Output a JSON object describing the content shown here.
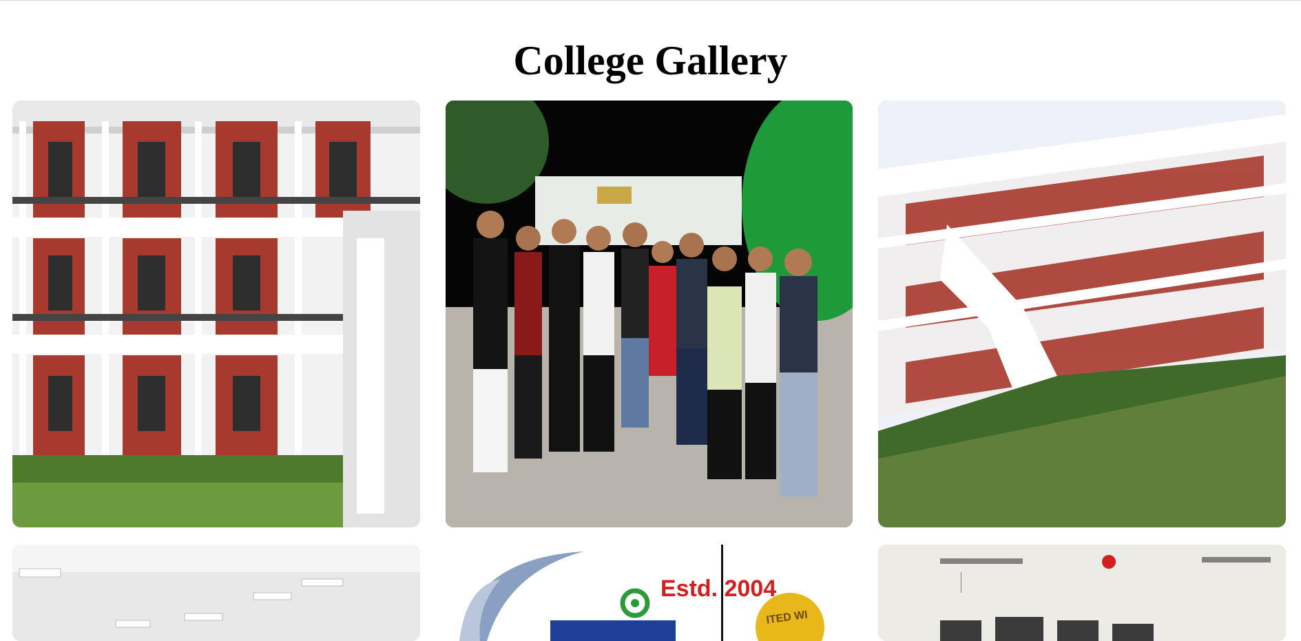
{
  "page": {
    "title": "College Gallery"
  },
  "gallery": {
    "items": [
      {
        "name": "building-wing-photo",
        "subject": "college building"
      },
      {
        "name": "students-group-photo",
        "subject": "students group at night"
      },
      {
        "name": "campus-lawn-photo",
        "subject": "college building with lawn"
      },
      {
        "name": "hall-interior-photo",
        "subject": "hall interior"
      },
      {
        "name": "college-logo-image",
        "estd": "Estd. 2004",
        "seal": "ITED WI"
      },
      {
        "name": "lab-interior-photo",
        "subject": "laboratory"
      }
    ]
  },
  "colors": {
    "brick": "#a8392e",
    "wall": "#efefef",
    "grass": "#5f8a3a",
    "logo_blue": "#1f3f9a",
    "logo_red": "#d21f1f",
    "logo_green": "#2c9a3a",
    "seal_gold": "#e8b81a"
  }
}
